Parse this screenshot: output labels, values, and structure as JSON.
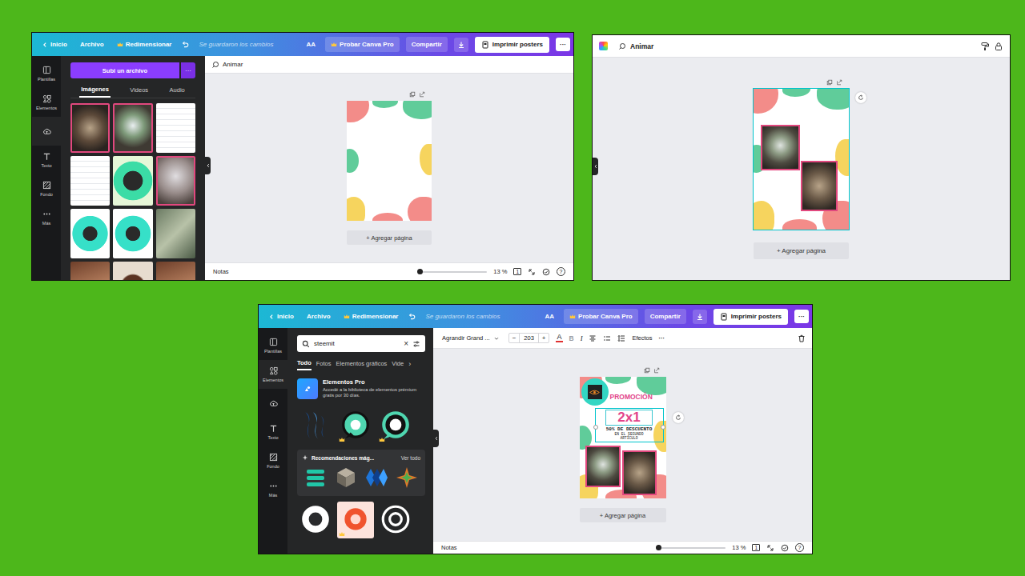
{
  "editor_upload": {
    "top_bar": {
      "back": "Inicio",
      "file": "Archivo",
      "resize": "Redimensionar",
      "saved": "Se guardaron los cambios",
      "text_toggle": "AA",
      "pro": "Probar Canva Pro",
      "share": "Compartir",
      "print": "Imprimir posters",
      "more": "···"
    },
    "nav": [
      {
        "label": "Plantillas",
        "selected": false
      },
      {
        "label": "Elementos",
        "selected": false
      },
      {
        "selected": true
      },
      {
        "label": "Texto",
        "selected": false
      },
      {
        "label": "Fondo",
        "selected": false
      },
      {
        "label": "Más",
        "selected": false
      }
    ],
    "panel": {
      "upload_button": "Subi un archivo",
      "upload_more": "···",
      "tabs": [
        {
          "label": "Imágenes",
          "selected": true
        },
        {
          "label": "Videos",
          "selected": false
        },
        {
          "label": "Audio",
          "selected": false
        }
      ]
    },
    "canvas": {
      "animate": "Animar",
      "add_page": "+ Agregar página"
    },
    "bottom_bar": {
      "notes": "Notas",
      "zoom": "13 %",
      "zoom_level": 0.0,
      "pages": "1",
      "help": "?"
    }
  },
  "canvas_view": {
    "animate": "Animar",
    "add_page": "+ Agregar página",
    "page_selected": true
  },
  "editor_elements": {
    "top_bar": {
      "back": "Inicio",
      "file": "Archivo",
      "resize": "Redimensionar",
      "saved": "Se guardaron los cambios",
      "text_toggle": "AA",
      "pro": "Probar Canva Pro",
      "share": "Compartir",
      "print": "Imprimir posters",
      "more": "···"
    },
    "nav": [
      {
        "label": "Plantillas",
        "selected": false
      },
      {
        "label": "Elementos",
        "selected": true
      },
      {
        "selected": false
      },
      {
        "label": "Texto",
        "selected": false
      },
      {
        "label": "Fondo",
        "selected": false
      },
      {
        "label": "Más",
        "selected": false
      }
    ],
    "search": {
      "value": "steemit",
      "clear": "×"
    },
    "tabs": [
      {
        "label": "Todo",
        "selected": true
      },
      {
        "label": "Fotos",
        "selected": false
      },
      {
        "label": "Elementos gráficos",
        "selected": false
      },
      {
        "label": "Vide",
        "selected": false
      }
    ],
    "tabs_more": "›",
    "pro": {
      "title": "Elementos Pro",
      "text": "Accedé a la biblioteca de elementos prémium gratis por 30 días."
    },
    "recommendations": {
      "title": "Recomendaciones mág...",
      "link": "Ver todo"
    },
    "text_toolbar": {
      "font": "Agrandir Grand ...",
      "minus": "−",
      "size": "203",
      "plus": "+",
      "color_letter": "A",
      "format": [
        {
          "label": "B",
          "disabled": true
        },
        {
          "label": "I",
          "disabled": false
        }
      ],
      "effects": "Efectos",
      "more": "···"
    },
    "design": {
      "title": "PROMOCIÓN",
      "offer": "2x1",
      "discount": "50% DE DESCUENTO",
      "line": "EN EL SEGUNDO",
      "line2": "ARTÍCULO",
      "text_selected": true
    },
    "add_page": "+ Agregar página",
    "bottom_bar": {
      "notes": "Notas",
      "zoom": "13 %",
      "zoom_level": 0.0,
      "pages": "1",
      "help": "?"
    }
  }
}
